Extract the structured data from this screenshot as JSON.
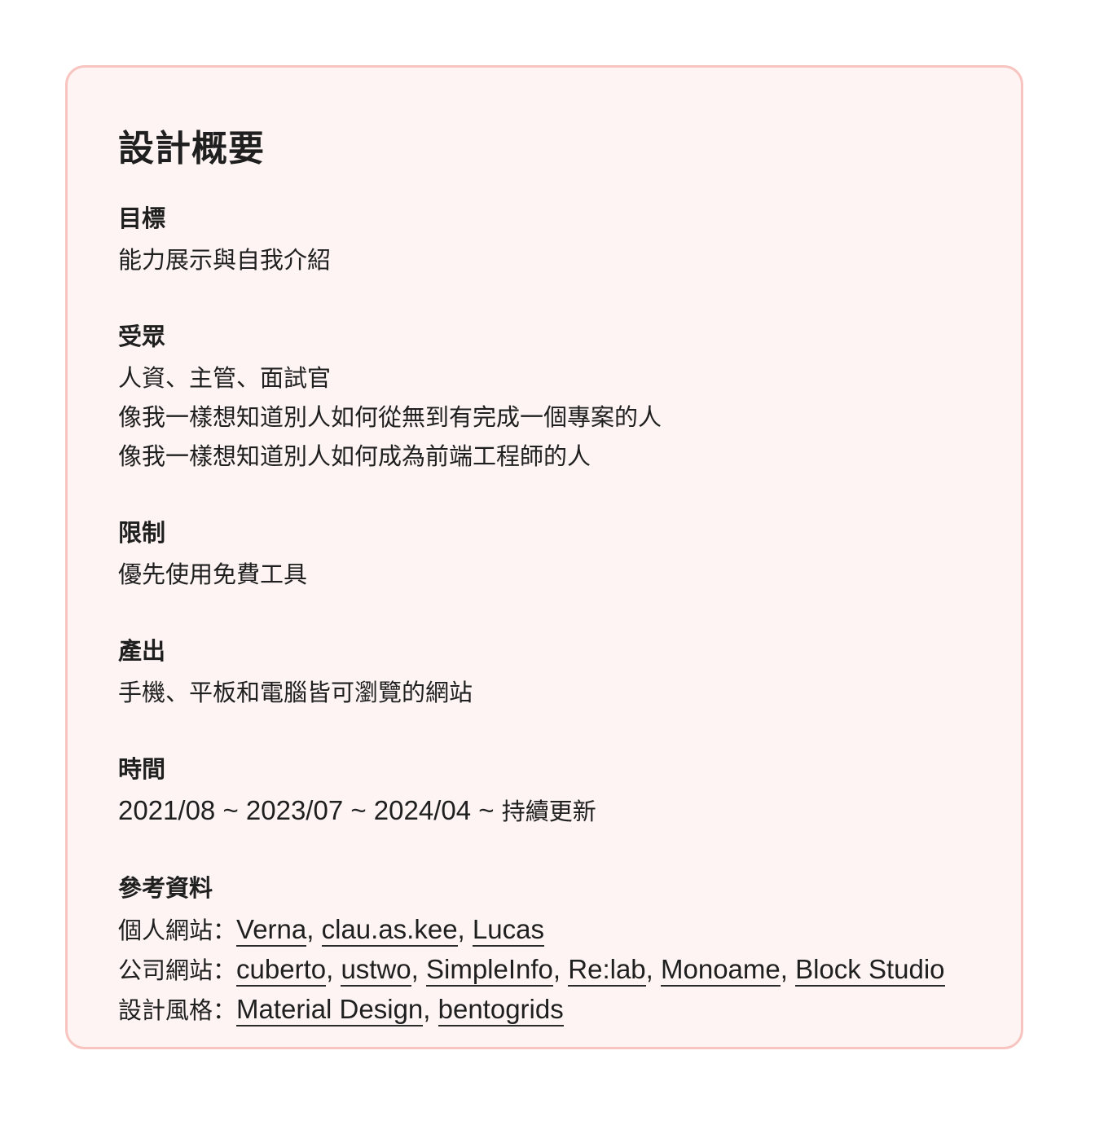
{
  "card": {
    "title": "設計概要",
    "goal": {
      "label": "目標",
      "lines": [
        "能力展示與自我介紹"
      ]
    },
    "audience": {
      "label": "受眾",
      "lines": [
        "人資、主管、面試官",
        "像我一樣想知道別人如何從無到有完成一個專案的人",
        "像我一樣想知道別人如何成為前端工程師的人"
      ]
    },
    "constraints": {
      "label": "限制",
      "lines": [
        "優先使用免費工具"
      ]
    },
    "output": {
      "label": "產出",
      "lines": [
        "手機、平板和電腦皆可瀏覽的網站"
      ]
    },
    "time": {
      "label": "時間",
      "dates": "2021/08 ~ 2023/07 ~ 2024/04 ~ ",
      "suffix": "持續更新"
    },
    "references": {
      "label": "參考資料",
      "personal": {
        "prefix": "個人網站：",
        "links": [
          "Verna",
          "clau.as.kee",
          "Lucas"
        ]
      },
      "company": {
        "prefix": "公司網站：",
        "links": [
          "cuberto",
          "ustwo",
          "SimpleInfo",
          "Re:lab",
          "Monoame",
          "Block Studio"
        ]
      },
      "design": {
        "prefix": "設計風格：",
        "links": [
          "Material Design",
          "bentogrids"
        ]
      },
      "separator": ", "
    }
  }
}
